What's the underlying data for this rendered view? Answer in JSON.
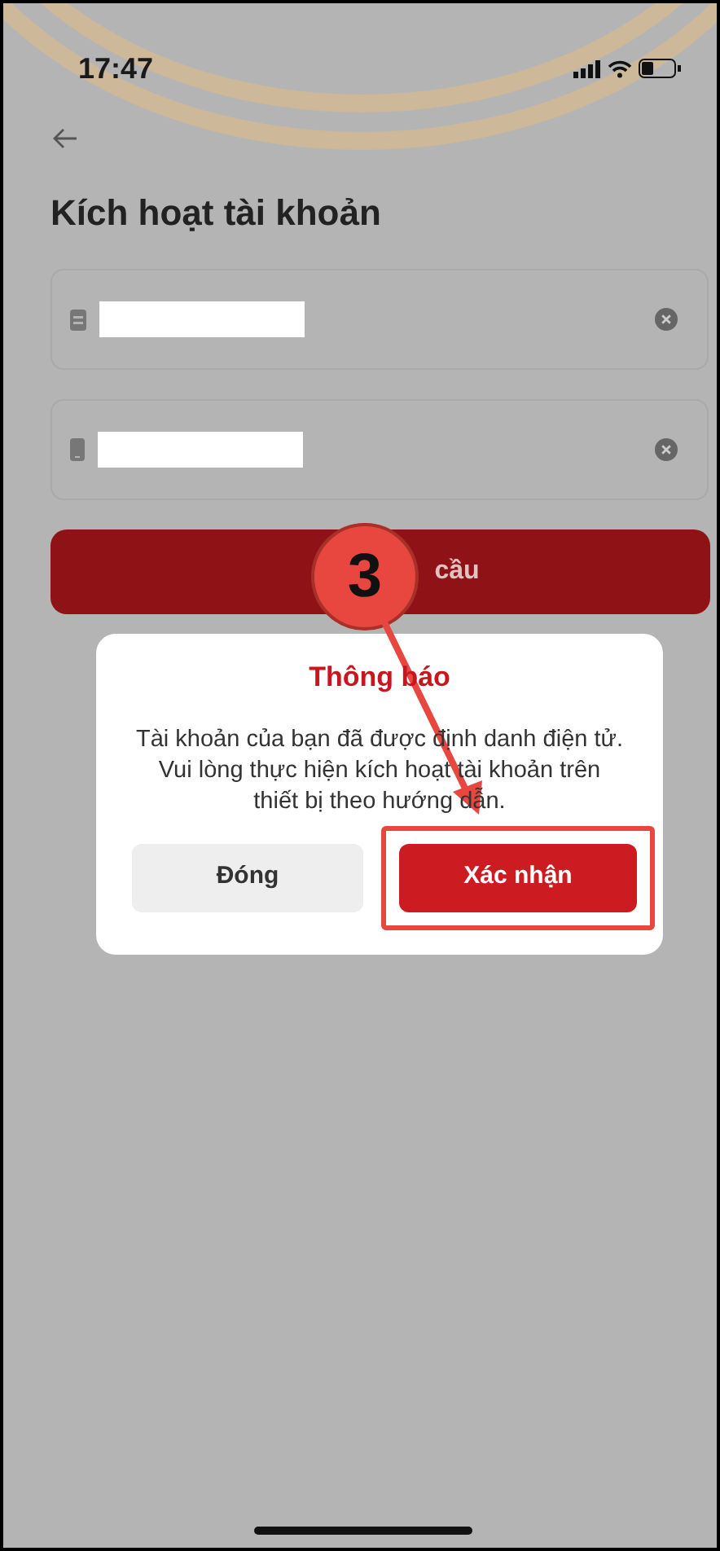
{
  "status_bar": {
    "time": "17:47"
  },
  "screen": {
    "title": "Kích hoạt tài khoản",
    "fields": [
      {
        "kind": "card"
      },
      {
        "kind": "phone"
      }
    ],
    "submit_button": {
      "label": "cầu"
    }
  },
  "dialog": {
    "title": "Thông báo",
    "message_lines": [
      "Tài khoản của bạn đã được định danh điện tử.",
      "Vui lòng thực hiện kích hoạt tài khoản trên",
      "thiết bị theo hướng dẫn."
    ],
    "buttons": [
      {
        "label": "Đóng",
        "kind": "secondary",
        "highlighted": false
      },
      {
        "label": "Xác nhận",
        "kind": "primary",
        "highlighted": true
      }
    ]
  },
  "annotation": {
    "step": "3"
  }
}
